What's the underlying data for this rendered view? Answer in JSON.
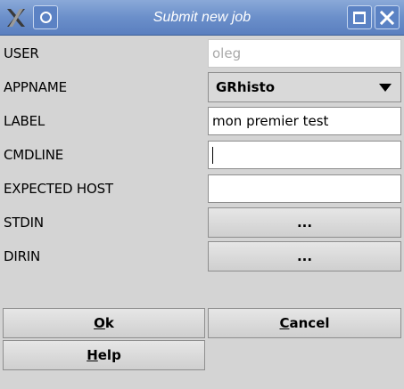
{
  "window": {
    "title": "Submit new job"
  },
  "form": {
    "user": {
      "label": "USER",
      "value": "oleg"
    },
    "appname": {
      "label": "APPNAME",
      "value": "GRhisto"
    },
    "label": {
      "label": "LABEL",
      "value": "mon premier test"
    },
    "cmdline": {
      "label": "CMDLINE",
      "value": ""
    },
    "expected_host": {
      "label": "EXPECTED HOST",
      "value": ""
    },
    "stdin": {
      "label": "STDIN",
      "button": "..."
    },
    "dirin": {
      "label": "DIRIN",
      "button": "..."
    }
  },
  "buttons": {
    "ok": {
      "mnemonic": "O",
      "rest": "k"
    },
    "cancel": {
      "mnemonic": "C",
      "rest": "ancel"
    },
    "help": {
      "mnemonic": "H",
      "rest": "elp"
    }
  },
  "icons": {
    "app": "x-logo-icon",
    "menu": "window-menu-icon",
    "maximize": "maximize-icon",
    "close": "close-icon"
  }
}
